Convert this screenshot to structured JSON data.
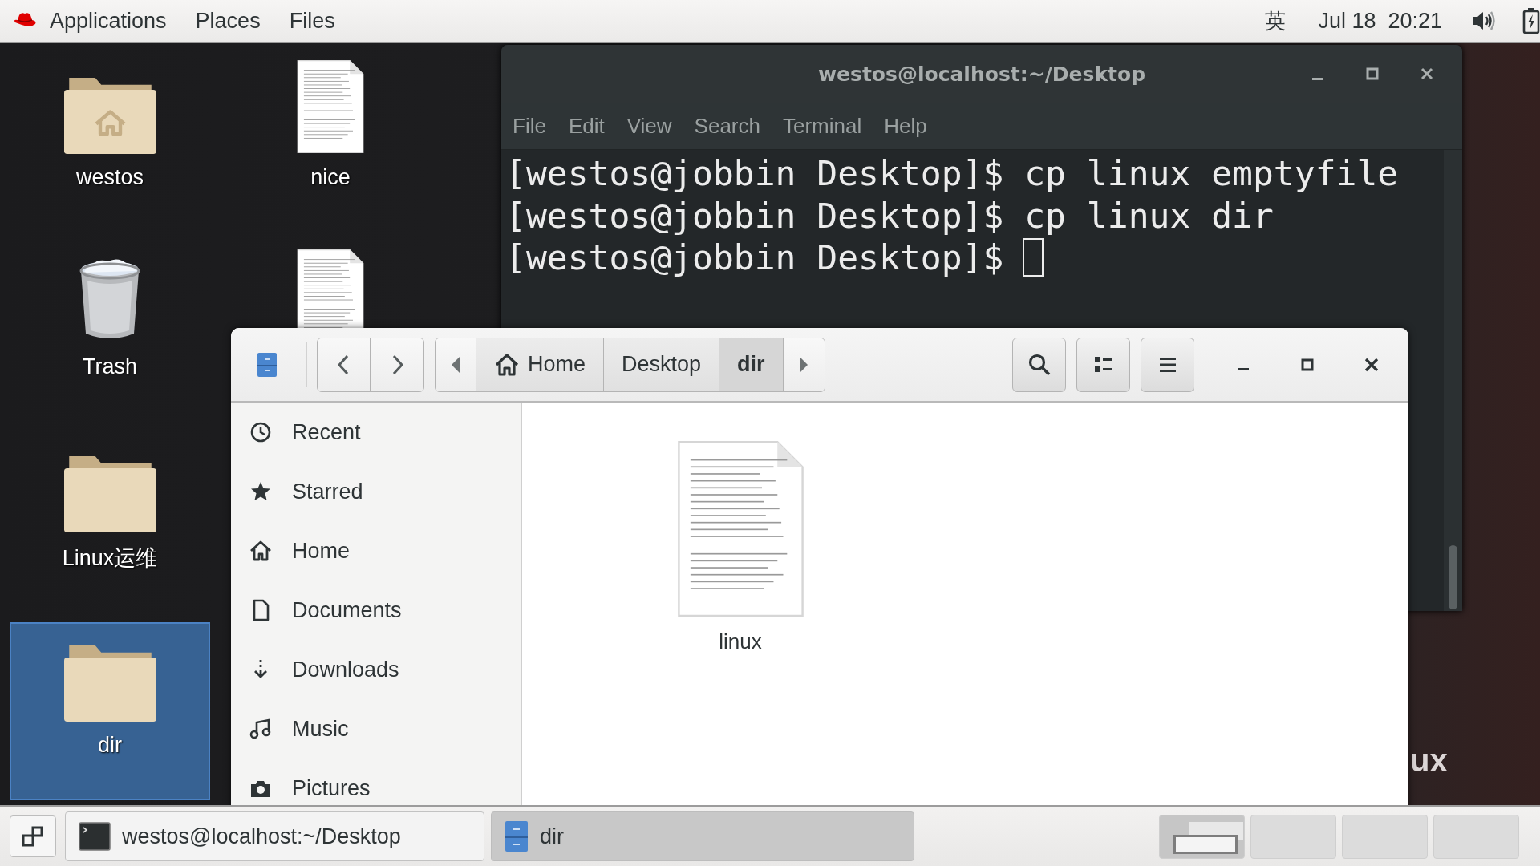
{
  "top_bar": {
    "menus": [
      {
        "label": "Applications"
      },
      {
        "label": "Places"
      },
      {
        "label": "Files"
      }
    ],
    "input_method": "英",
    "clock": "Jul 18  20:21"
  },
  "desktop": {
    "icons": [
      {
        "label": "westos",
        "kind": "home-folder",
        "selected": false
      },
      {
        "label": "Trash",
        "kind": "trash",
        "selected": false
      },
      {
        "label": "Linux运维",
        "kind": "folder",
        "selected": false
      },
      {
        "label": "dir",
        "kind": "folder",
        "selected": true
      },
      {
        "label": "nice",
        "kind": "document",
        "selected": false
      },
      {
        "kind": "document",
        "selected": false
      }
    ],
    "wallpaper_text": "ux"
  },
  "terminal": {
    "title": "westos@localhost:~/Desktop",
    "menu": [
      "File",
      "Edit",
      "View",
      "Search",
      "Terminal",
      "Help"
    ],
    "lines": [
      "[westos@jobbin Desktop]$ cp linux emptyfile",
      "[westos@jobbin Desktop]$ cp linux dir",
      "[westos@jobbin Desktop]$"
    ],
    "cursor": true
  },
  "files": {
    "path": [
      {
        "label": "Home",
        "kind": "home",
        "selected": false
      },
      {
        "label": "Desktop",
        "kind": "folder",
        "selected": false
      },
      {
        "label": "dir",
        "kind": "folder",
        "selected": true
      }
    ],
    "sidebar": [
      {
        "label": "Recent",
        "kind": "recent"
      },
      {
        "label": "Starred",
        "kind": "starred"
      },
      {
        "label": "Home",
        "kind": "home"
      },
      {
        "label": "Documents",
        "kind": "documents"
      },
      {
        "label": "Downloads",
        "kind": "downloads"
      },
      {
        "label": "Music",
        "kind": "music"
      },
      {
        "label": "Pictures",
        "kind": "pictures"
      }
    ],
    "items": [
      {
        "label": "linux",
        "kind": "document"
      }
    ]
  },
  "taskbar": {
    "windows": [
      {
        "label": "westos@localhost:~/Desktop",
        "kind": "terminal",
        "selected": false
      },
      {
        "label": "dir",
        "kind": "files",
        "selected": true
      }
    ],
    "workspaces": [
      {
        "selected": true
      },
      {
        "selected": false
      },
      {
        "selected": false
      },
      {
        "selected": false
      }
    ]
  }
}
